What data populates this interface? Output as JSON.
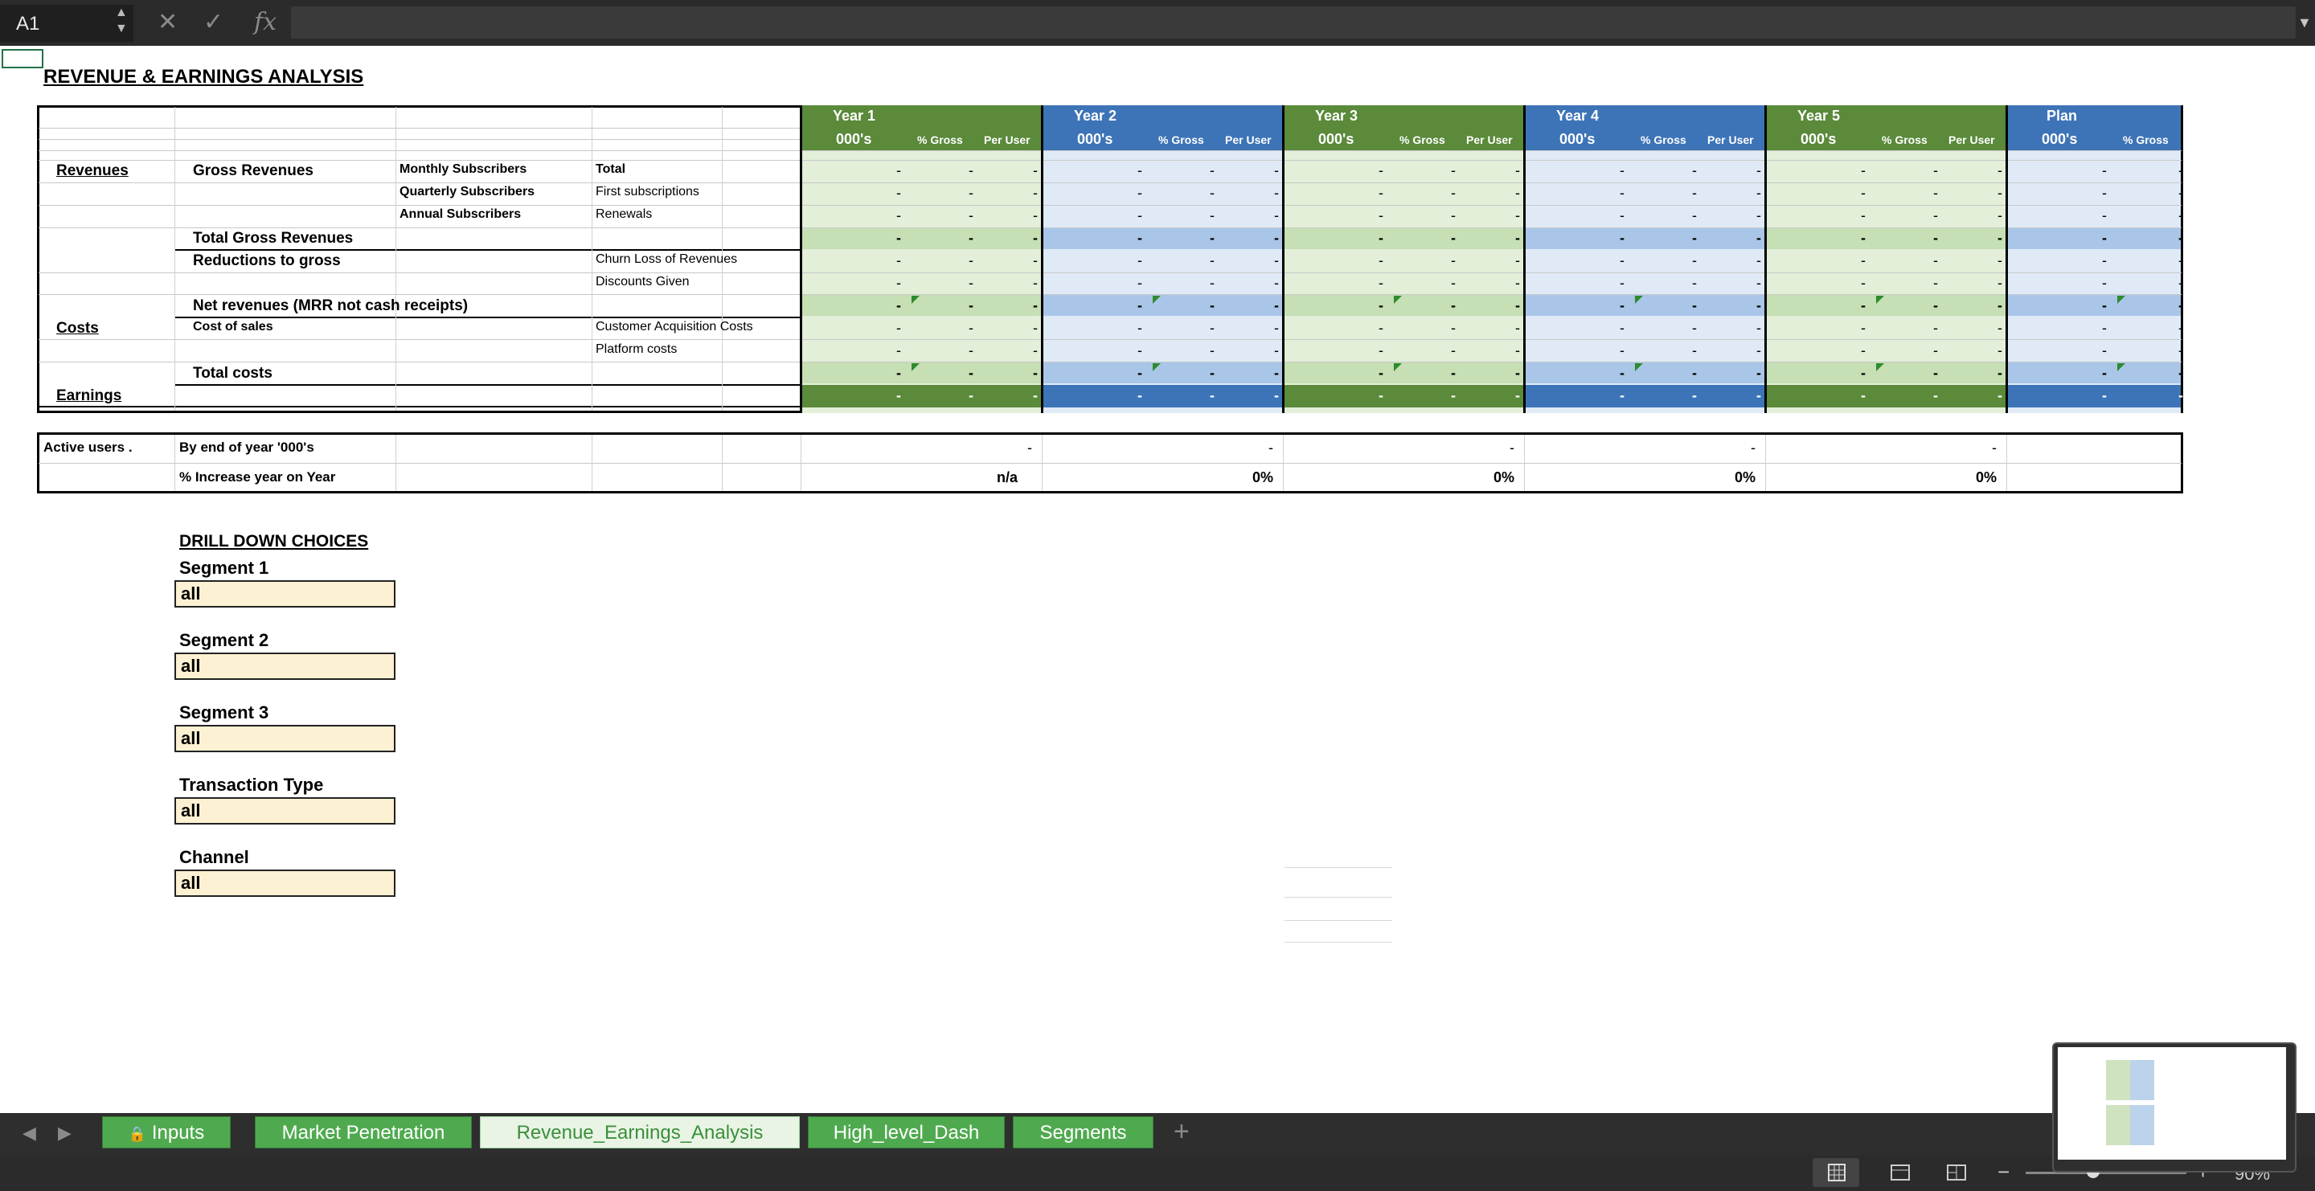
{
  "formula_bar": {
    "cell_ref": "A1",
    "cancel_glyph": "✕",
    "confirm_glyph": "✓",
    "fx_label": "fx",
    "formula_value": ""
  },
  "sheet": {
    "title": "REVENUE & EARNINGS ANALYSIS",
    "year_headers": [
      "Year 1",
      "Year 2",
      "Year 3",
      "Year 4",
      "Year 5",
      "Plan"
    ],
    "subheaders": {
      "thousands": "000's",
      "pct_gross": "% Gross",
      "per_user": "Per User"
    },
    "rows": {
      "revenues": "Revenues",
      "gross_revenues": "Gross Revenues",
      "monthly_subscribers": "Monthly Subscribers",
      "quarterly_subscribers": "Quarterly Subscribers",
      "annual_subscribers": "Annual Subscribers",
      "total": "Total",
      "first_subscriptions": "First subscriptions",
      "renewals": "Renewals",
      "total_gross_revenues": "Total Gross Revenues",
      "reductions_to_gross": "Reductions to gross",
      "churn_loss": "Churn Loss of Revenues",
      "discounts_given": "Discounts Given",
      "net_revenues": "Net revenues (MRR not cash receipts)",
      "costs": "Costs",
      "cost_of_sales": "Cost of sales",
      "customer_acquisition_costs": "Customer Acquisition Costs",
      "platform_costs": "Platform costs",
      "total_costs": "Total costs",
      "earnings": "Earnings"
    },
    "empty_value": "-",
    "active_users": {
      "label": "Active users .",
      "by_end_of_year": "By end of year '000's",
      "pct_increase": "% Increase year on Year",
      "values": [
        "-",
        "-",
        "-",
        "-",
        "-"
      ],
      "pct_values": [
        "n/a",
        "0%",
        "0%",
        "0%",
        "0%"
      ]
    },
    "drill_down": {
      "title": "DRILL DOWN CHOICES",
      "choices": [
        {
          "label": "Segment 1",
          "value": "all"
        },
        {
          "label": "Segment 2",
          "value": "all"
        },
        {
          "label": "Segment 3",
          "value": "all"
        },
        {
          "label": "Transaction Type",
          "value": "all"
        },
        {
          "label": "Channel",
          "value": "all"
        }
      ]
    }
  },
  "tabs": [
    {
      "label": "Inputs",
      "locked": true,
      "active": false
    },
    {
      "label": "Market Penetration",
      "active": false
    },
    {
      "label": "Revenue_Earnings_Analysis",
      "active": true
    },
    {
      "label": "High_level_Dash",
      "active": false
    },
    {
      "label": "Segments",
      "active": false
    }
  ],
  "add_sheet_glyph": "+",
  "status_bar": {
    "zoom": "90%",
    "zoom_minus": "−",
    "zoom_plus": "+"
  },
  "colors": {
    "green_header": "#5a8a3a",
    "blue_header": "#3d74b7",
    "green_light": "#e3efd9",
    "blue_light": "#dfeaf6",
    "green_band": "#c6dfb4",
    "blue_band": "#a9c6e8",
    "tab_green": "#4faa4f",
    "input_fill": "#fdf1d3"
  }
}
